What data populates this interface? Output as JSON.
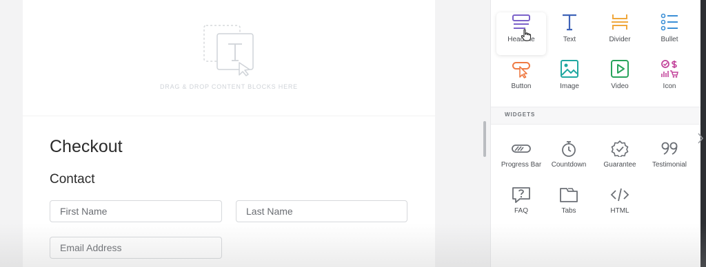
{
  "canvas": {
    "drop_zone_text": "DRAG & DROP CONTENT BLOCKS HERE",
    "page_title": "Checkout",
    "section_title": "Contact",
    "fields": {
      "first_name_placeholder": "First Name",
      "last_name_placeholder": "Last Name",
      "email_placeholder": "Email Address"
    }
  },
  "panel": {
    "blocks": [
      {
        "label": "Headline",
        "icon": "headline-icon",
        "color": "#7b61c9"
      },
      {
        "label": "Text",
        "icon": "text-icon",
        "color": "#3f63b8"
      },
      {
        "label": "Divider",
        "icon": "divider-icon",
        "color": "#f0a73b"
      },
      {
        "label": "Bullet",
        "icon": "bullet-icon",
        "color": "#3b8fd6"
      },
      {
        "label": "Button",
        "icon": "button-icon",
        "color": "#ef7a43"
      },
      {
        "label": "Image",
        "icon": "image-icon",
        "color": "#1fa7a0"
      },
      {
        "label": "Video",
        "icon": "video-icon",
        "color": "#27a35b"
      },
      {
        "label": "Icon",
        "icon": "icon-icon",
        "color": "#c2429a"
      }
    ],
    "widgets_heading": "WIDGETS",
    "widgets": [
      {
        "label": "Progress Bar",
        "icon": "progress-bar-icon"
      },
      {
        "label": "Countdown",
        "icon": "countdown-icon"
      },
      {
        "label": "Guarantee",
        "icon": "guarantee-icon"
      },
      {
        "label": "Testimonial",
        "icon": "testimonial-icon"
      },
      {
        "label": "FAQ",
        "icon": "faq-icon"
      },
      {
        "label": "Tabs",
        "icon": "tabs-icon"
      },
      {
        "label": "HTML",
        "icon": "html-icon"
      }
    ]
  }
}
